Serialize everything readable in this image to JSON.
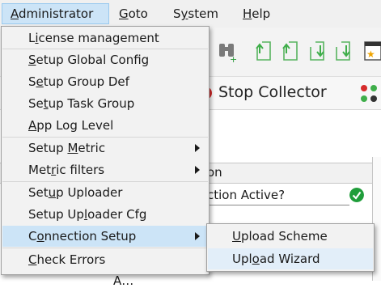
{
  "menubar": {
    "items": [
      {
        "label": "Administrator",
        "underline": "A"
      },
      {
        "label": "Goto",
        "underline": "G"
      },
      {
        "label": "System",
        "underline": "y"
      },
      {
        "label": "Help",
        "underline": "H"
      }
    ]
  },
  "app": {
    "stop_collector_label": "Stop Collector",
    "column_header": "on",
    "row1_label": "ction Active?",
    "bottom_row_text": "A…"
  },
  "admin_menu": {
    "items": [
      {
        "pre": "L",
        "ul": "i",
        "post": "cense management"
      },
      {
        "pre": "",
        "ul": "S",
        "post": "etup Global Config"
      },
      {
        "pre": "S",
        "ul": "e",
        "post": "tup Group Def"
      },
      {
        "pre": "Se",
        "ul": "t",
        "post": "up Task Group"
      },
      {
        "pre": "",
        "ul": "A",
        "post": "pp Log Level"
      },
      {
        "pre": "Setup ",
        "ul": "M",
        "post": "etric"
      },
      {
        "pre": "Met",
        "ul": "r",
        "post": "ic filters"
      },
      {
        "pre": "Set",
        "ul": "u",
        "post": "p Uploader"
      },
      {
        "pre": "Setup Up",
        "ul": "l",
        "post": "oader Cfg"
      },
      {
        "pre": "C",
        "ul": "o",
        "post": "nnection Setup"
      },
      {
        "pre": "",
        "ul": "C",
        "post": "heck Errors"
      }
    ]
  },
  "sub_menu": {
    "items": [
      {
        "pre": "",
        "ul": "U",
        "post": "pload Scheme"
      },
      {
        "pre": "Upl",
        "ul": "o",
        "post": "ad Wizard"
      }
    ]
  },
  "colors": {
    "menu_highlight": "#cce4f7",
    "check_green": "#1f9d3a",
    "stop_red": "#d62b2b",
    "upload_green": "#3fae4a"
  },
  "icons": {
    "toolbar": [
      "binoculars-icon",
      "upload-icon",
      "download-icon",
      "calendar-star-icon"
    ],
    "collector": [
      "stop-icon",
      "network-icon"
    ],
    "status": "check-circle-icon",
    "submenu": "chevron-right-icon"
  }
}
